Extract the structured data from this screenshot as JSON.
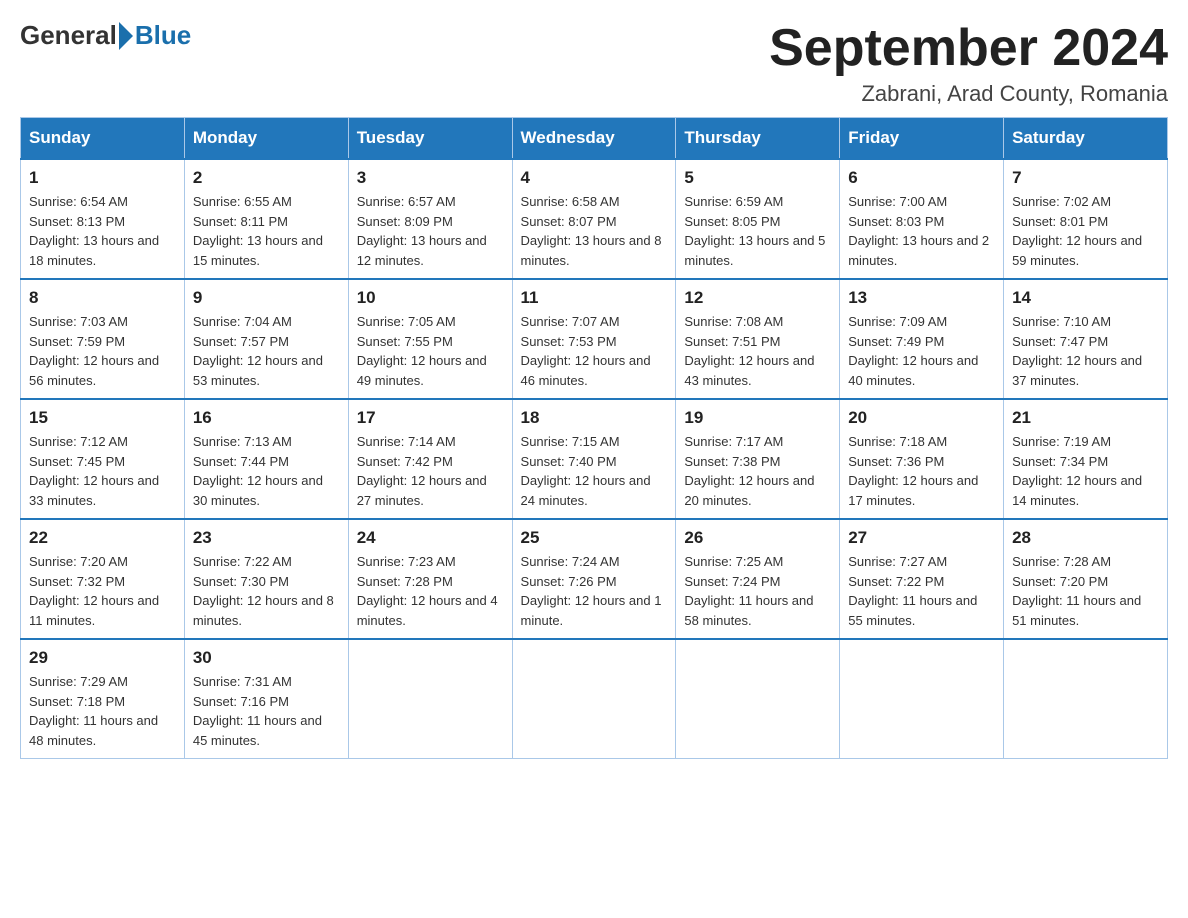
{
  "header": {
    "logo_general": "General",
    "logo_blue": "Blue",
    "month_title": "September 2024",
    "location": "Zabrani, Arad County, Romania"
  },
  "weekdays": [
    "Sunday",
    "Monday",
    "Tuesday",
    "Wednesday",
    "Thursday",
    "Friday",
    "Saturday"
  ],
  "weeks": [
    [
      {
        "day": "1",
        "sunrise": "6:54 AM",
        "sunset": "8:13 PM",
        "daylight": "13 hours and 18 minutes."
      },
      {
        "day": "2",
        "sunrise": "6:55 AM",
        "sunset": "8:11 PM",
        "daylight": "13 hours and 15 minutes."
      },
      {
        "day": "3",
        "sunrise": "6:57 AM",
        "sunset": "8:09 PM",
        "daylight": "13 hours and 12 minutes."
      },
      {
        "day": "4",
        "sunrise": "6:58 AM",
        "sunset": "8:07 PM",
        "daylight": "13 hours and 8 minutes."
      },
      {
        "day": "5",
        "sunrise": "6:59 AM",
        "sunset": "8:05 PM",
        "daylight": "13 hours and 5 minutes."
      },
      {
        "day": "6",
        "sunrise": "7:00 AM",
        "sunset": "8:03 PM",
        "daylight": "13 hours and 2 minutes."
      },
      {
        "day": "7",
        "sunrise": "7:02 AM",
        "sunset": "8:01 PM",
        "daylight": "12 hours and 59 minutes."
      }
    ],
    [
      {
        "day": "8",
        "sunrise": "7:03 AM",
        "sunset": "7:59 PM",
        "daylight": "12 hours and 56 minutes."
      },
      {
        "day": "9",
        "sunrise": "7:04 AM",
        "sunset": "7:57 PM",
        "daylight": "12 hours and 53 minutes."
      },
      {
        "day": "10",
        "sunrise": "7:05 AM",
        "sunset": "7:55 PM",
        "daylight": "12 hours and 49 minutes."
      },
      {
        "day": "11",
        "sunrise": "7:07 AM",
        "sunset": "7:53 PM",
        "daylight": "12 hours and 46 minutes."
      },
      {
        "day": "12",
        "sunrise": "7:08 AM",
        "sunset": "7:51 PM",
        "daylight": "12 hours and 43 minutes."
      },
      {
        "day": "13",
        "sunrise": "7:09 AM",
        "sunset": "7:49 PM",
        "daylight": "12 hours and 40 minutes."
      },
      {
        "day": "14",
        "sunrise": "7:10 AM",
        "sunset": "7:47 PM",
        "daylight": "12 hours and 37 minutes."
      }
    ],
    [
      {
        "day": "15",
        "sunrise": "7:12 AM",
        "sunset": "7:45 PM",
        "daylight": "12 hours and 33 minutes."
      },
      {
        "day": "16",
        "sunrise": "7:13 AM",
        "sunset": "7:44 PM",
        "daylight": "12 hours and 30 minutes."
      },
      {
        "day": "17",
        "sunrise": "7:14 AM",
        "sunset": "7:42 PM",
        "daylight": "12 hours and 27 minutes."
      },
      {
        "day": "18",
        "sunrise": "7:15 AM",
        "sunset": "7:40 PM",
        "daylight": "12 hours and 24 minutes."
      },
      {
        "day": "19",
        "sunrise": "7:17 AM",
        "sunset": "7:38 PM",
        "daylight": "12 hours and 20 minutes."
      },
      {
        "day": "20",
        "sunrise": "7:18 AM",
        "sunset": "7:36 PM",
        "daylight": "12 hours and 17 minutes."
      },
      {
        "day": "21",
        "sunrise": "7:19 AM",
        "sunset": "7:34 PM",
        "daylight": "12 hours and 14 minutes."
      }
    ],
    [
      {
        "day": "22",
        "sunrise": "7:20 AM",
        "sunset": "7:32 PM",
        "daylight": "12 hours and 11 minutes."
      },
      {
        "day": "23",
        "sunrise": "7:22 AM",
        "sunset": "7:30 PM",
        "daylight": "12 hours and 8 minutes."
      },
      {
        "day": "24",
        "sunrise": "7:23 AM",
        "sunset": "7:28 PM",
        "daylight": "12 hours and 4 minutes."
      },
      {
        "day": "25",
        "sunrise": "7:24 AM",
        "sunset": "7:26 PM",
        "daylight": "12 hours and 1 minute."
      },
      {
        "day": "26",
        "sunrise": "7:25 AM",
        "sunset": "7:24 PM",
        "daylight": "11 hours and 58 minutes."
      },
      {
        "day": "27",
        "sunrise": "7:27 AM",
        "sunset": "7:22 PM",
        "daylight": "11 hours and 55 minutes."
      },
      {
        "day": "28",
        "sunrise": "7:28 AM",
        "sunset": "7:20 PM",
        "daylight": "11 hours and 51 minutes."
      }
    ],
    [
      {
        "day": "29",
        "sunrise": "7:29 AM",
        "sunset": "7:18 PM",
        "daylight": "11 hours and 48 minutes."
      },
      {
        "day": "30",
        "sunrise": "7:31 AM",
        "sunset": "7:16 PM",
        "daylight": "11 hours and 45 minutes."
      },
      null,
      null,
      null,
      null,
      null
    ]
  ]
}
